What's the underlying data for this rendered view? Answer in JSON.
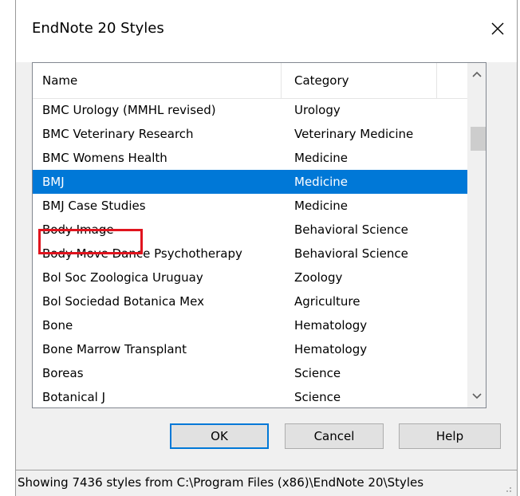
{
  "window": {
    "title": "EndNote 20 Styles",
    "close_icon": "close-icon"
  },
  "list": {
    "columns": [
      "Name",
      "Category"
    ],
    "rows": [
      {
        "name": "BMC Urology (MMHL revised)",
        "category": "Urology"
      },
      {
        "name": "BMC Veterinary Research",
        "category": "Veterinary Medicine"
      },
      {
        "name": "BMC Womens Health",
        "category": "Medicine"
      },
      {
        "name": "BMJ",
        "category": "Medicine",
        "selected": true
      },
      {
        "name": "BMJ Case Studies",
        "category": "Medicine"
      },
      {
        "name": "Body Image",
        "category": "Behavioral Science"
      },
      {
        "name": "Body Move Dance Psychotherapy",
        "category": "Behavioral Science"
      },
      {
        "name": "Bol Soc Zoologica Uruguay",
        "category": "Zoology"
      },
      {
        "name": "Bol Sociedad Botanica Mex",
        "category": "Agriculture"
      },
      {
        "name": "Bone",
        "category": "Hematology"
      },
      {
        "name": "Bone Marrow Transplant",
        "category": "Hematology"
      },
      {
        "name": "Boreas",
        "category": "Science"
      },
      {
        "name": "Botanical J",
        "category": "Science"
      }
    ],
    "selected_color": "#0078d7",
    "highlight_color": "#e0141e"
  },
  "buttons": {
    "ok": "OK",
    "cancel": "Cancel",
    "help": "Help"
  },
  "status": {
    "text": "Showing 7436 styles from C:\\Program Files (x86)\\EndNote 20\\Styles"
  }
}
